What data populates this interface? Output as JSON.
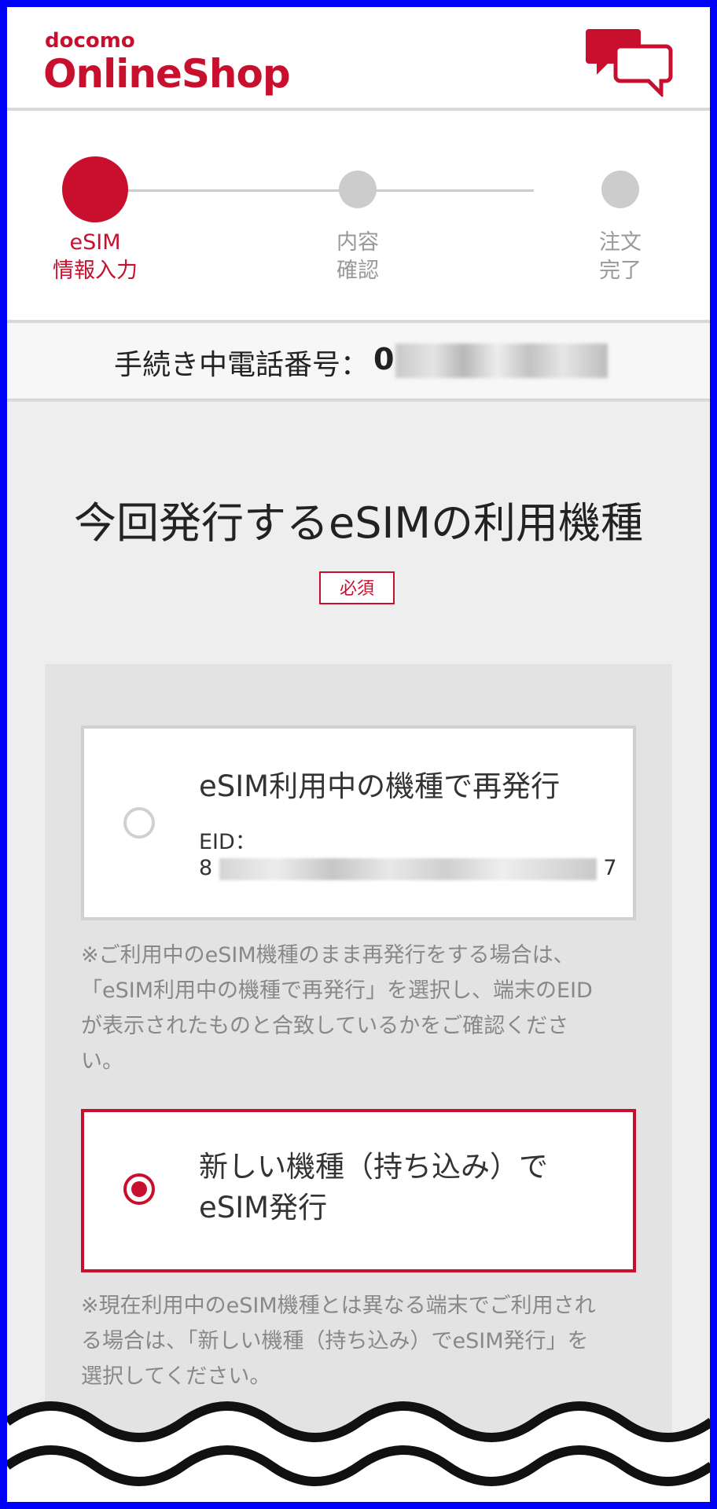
{
  "header": {
    "logo_small": "docomo",
    "logo_big": "OnlineShop",
    "chat_icon": "chat-bubbles-icon",
    "brand_color": "#c8102e"
  },
  "stepper": {
    "steps": [
      {
        "line1": "eSIM",
        "line2": "情報入力",
        "active": true
      },
      {
        "line1": "内容",
        "line2": "確認",
        "active": false
      },
      {
        "line1": "注文",
        "line2": "完了",
        "active": false
      }
    ],
    "active_color": "#c8102e",
    "inactive_color": "#cccccc"
  },
  "phone": {
    "label": "手続き中電話番号：",
    "number_visible": "0"
  },
  "main": {
    "title": "今回発行するeSIMの利用機種",
    "required_badge": "必須",
    "options": [
      {
        "title": "eSIM利用中の機種で再発行",
        "eid_label": "EID：",
        "eid_first": "8",
        "eid_last": "7",
        "selected": false
      },
      {
        "title_line1": "新しい機種（持ち込み）で",
        "title_line2": "eSIM発行",
        "selected": true
      }
    ],
    "note1": [
      "※ご利用中のeSIM機種のまま再発行をする場合は、",
      "「eSIM利用中の機種で再発行」を選択し、端末のEID",
      "が表示されたものと合致しているかをご確認くださ",
      "い。"
    ],
    "note2": [
      "※現在利用中のeSIM機種とは異なる端末でご利用され",
      "る場合は、「新しい機種（持ち込み）でeSIM発行」を",
      "選択してください。"
    ]
  }
}
